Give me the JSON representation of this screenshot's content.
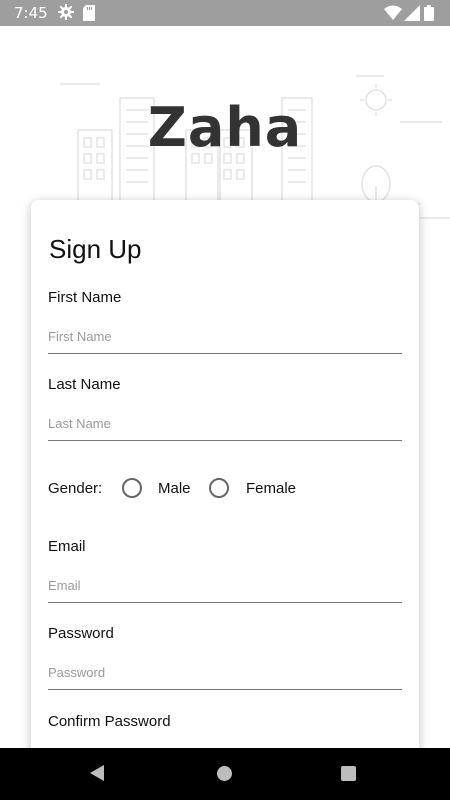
{
  "status_bar": {
    "time": "7:45"
  },
  "header": {
    "logo_text": "Zaha"
  },
  "form": {
    "title": "Sign Up",
    "first_name": {
      "label": "First Name",
      "placeholder": "First Name"
    },
    "last_name": {
      "label": "Last Name",
      "placeholder": "Last Name"
    },
    "gender": {
      "label": "Gender:",
      "options": [
        "Male",
        "Female"
      ]
    },
    "email": {
      "label": "Email",
      "placeholder": "Email"
    },
    "password": {
      "label": "Password",
      "placeholder": "Password"
    },
    "confirm_password": {
      "label": "Confirm Password"
    }
  },
  "icons": {
    "status": [
      "gear-icon",
      "sd-card-icon",
      "wifi-icon",
      "signal-icon",
      "battery-icon"
    ],
    "nav": [
      "back-icon",
      "home-icon",
      "recents-icon"
    ]
  }
}
